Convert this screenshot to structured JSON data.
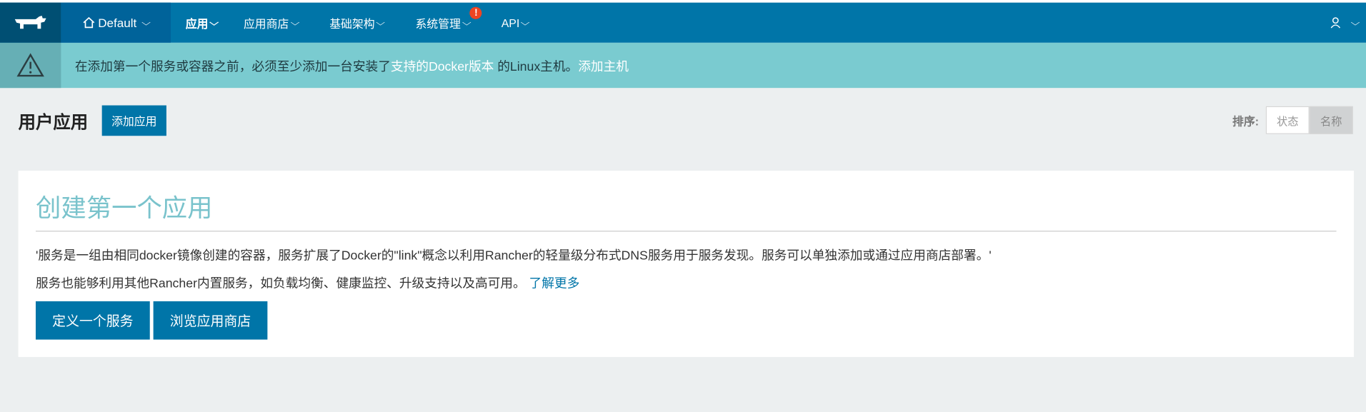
{
  "nav": {
    "environment": "Default",
    "items": [
      {
        "label": "应用",
        "active": true
      },
      {
        "label": "应用商店"
      },
      {
        "label": "基础架构"
      },
      {
        "label": "系统管理",
        "badge": "!"
      },
      {
        "label": "API"
      }
    ]
  },
  "alert": {
    "text_before": "在添加第一个服务或容器之前，必须至少添加一台安装了",
    "link_supported_docker": "支持的Docker版本",
    "text_middle": " 的Linux主机。",
    "link_add_host": "添加主机"
  },
  "header": {
    "title": "用户应用",
    "add_button": "添加应用",
    "sort_label": "排序:",
    "sort_options": [
      "状态",
      "名称"
    ]
  },
  "card": {
    "title": "创建第一个应用",
    "line1": "'服务是一组由相同docker镜像创建的容器，服务扩展了Docker的\"link\"概念以利用Rancher的轻量级分布式DNS服务用于服务发现。服务可以单独添加或通过应用商店部署。'",
    "line2": "服务也能够利用其他Rancher内置服务，如负载均衡、健康监控、升级支持以及高可用。",
    "learn_more": "了解更多",
    "buttons": [
      "定义一个服务",
      "浏览应用商店"
    ]
  },
  "colors": {
    "nav_bg": "#0075a8",
    "alert_bg": "#7acbd0",
    "accent": "#0075a8",
    "card_title": "#7ac3cc"
  }
}
